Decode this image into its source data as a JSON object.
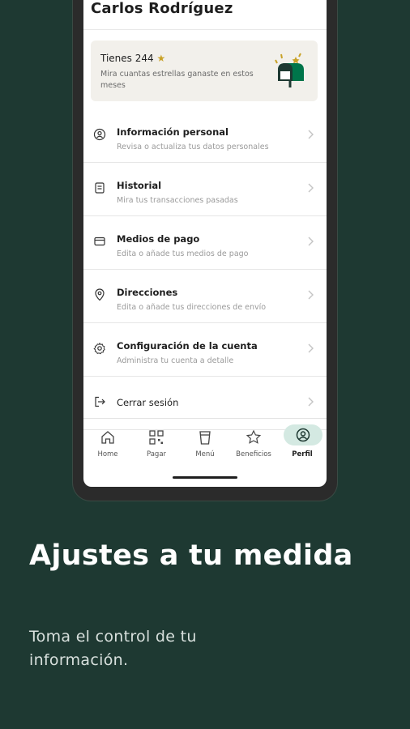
{
  "profile": {
    "name": "Carlos Rodríguez"
  },
  "stars_card": {
    "title": "Tienes 244",
    "star_glyph": "★",
    "subtitle": "Mira cuantas estrellas ganaste en estos meses",
    "icon": "mailbox-icon"
  },
  "menu": [
    {
      "title": "Información personal",
      "subtitle": "Revisa o actualiza tus datos personales",
      "icon": "person-icon"
    },
    {
      "title": "Historial",
      "subtitle": "Mira tus transacciones pasadas",
      "icon": "receipt-icon"
    },
    {
      "title": "Medios de pago",
      "subtitle": "Edita o añade tus medios de pago",
      "icon": "card-icon"
    },
    {
      "title": "Direcciones",
      "subtitle": "Edita o añade tus direcciones de envío",
      "icon": "location-pin-icon"
    },
    {
      "title": "Configuración de la cuenta",
      "subtitle": "Administra tu cuenta a detalle",
      "icon": "gear-icon"
    },
    {
      "title": "Cerrar sesión",
      "subtitle": "",
      "icon": "logout-icon"
    }
  ],
  "tabs": [
    {
      "label": "Home",
      "icon": "home-icon"
    },
    {
      "label": "Pagar",
      "icon": "qr-icon"
    },
    {
      "label": "Menú",
      "icon": "cup-icon"
    },
    {
      "label": "Beneficios",
      "icon": "star-icon"
    },
    {
      "label": "Perfil",
      "icon": "profile-icon",
      "active": true
    }
  ],
  "promo": {
    "headline": "Ajustes a tu medida",
    "subtext": "Toma el control de tu información."
  },
  "colors": {
    "background": "#1e3932",
    "active_tab_pill": "#d4e9e2",
    "star": "#c9a227",
    "mailbox": "#00754a"
  }
}
